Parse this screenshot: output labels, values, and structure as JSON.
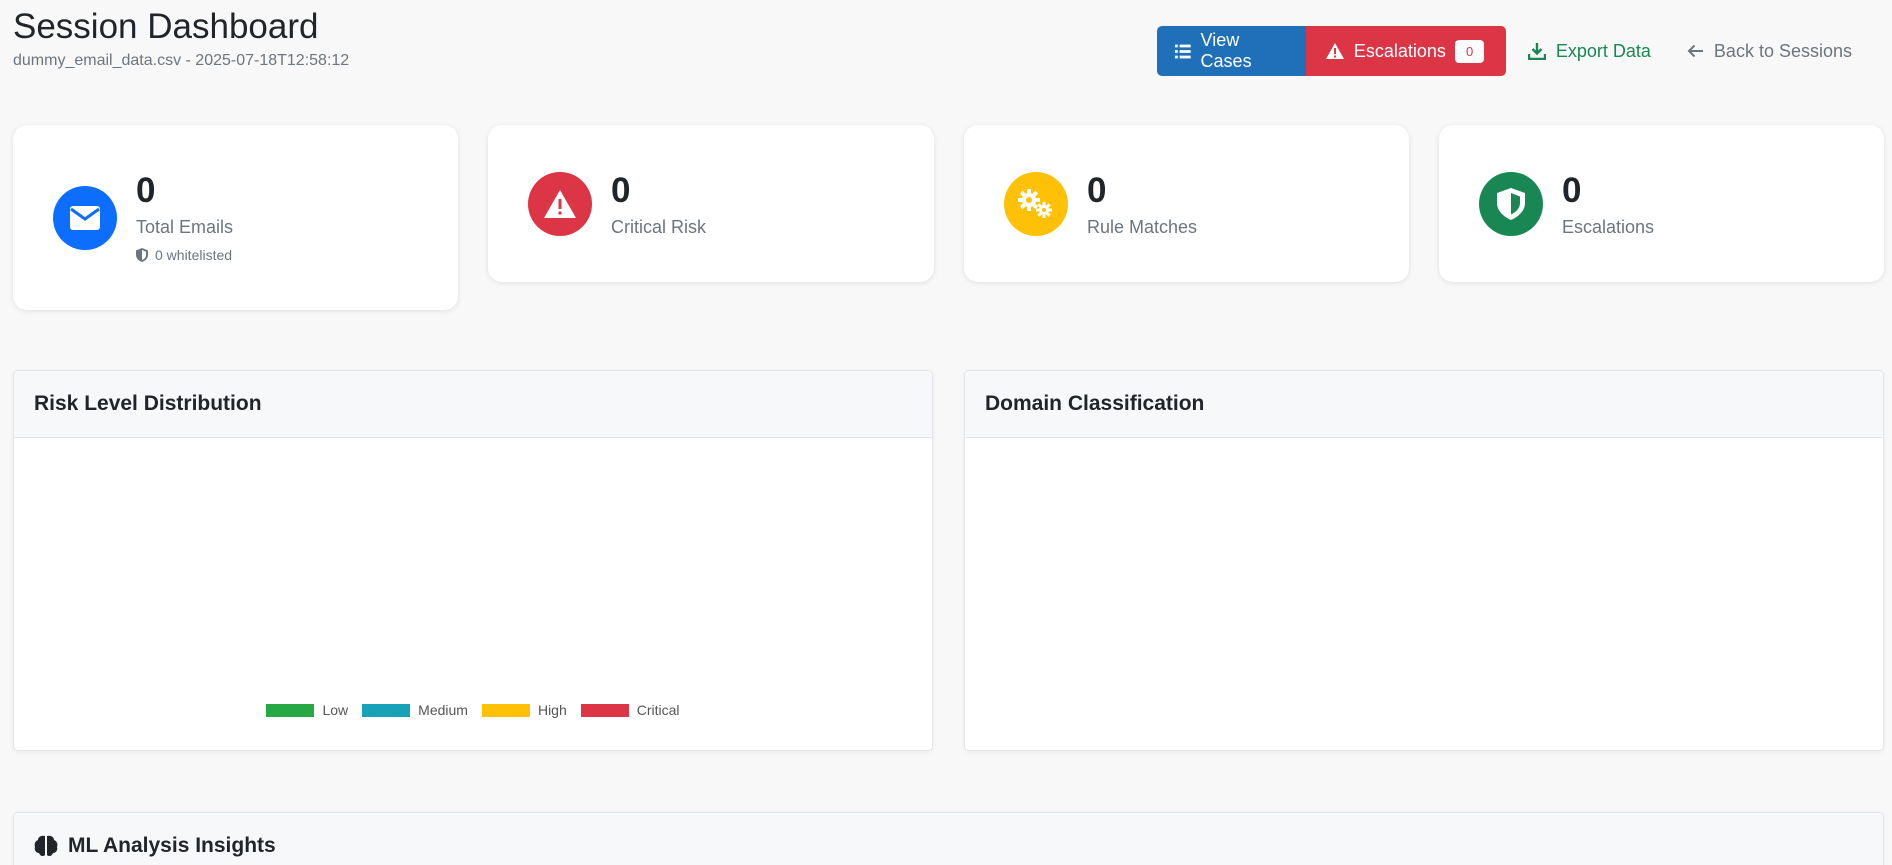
{
  "header": {
    "title": "Session Dashboard",
    "subtitle": "dummy_email_data.csv - 2025-07-18T12:58:12"
  },
  "actions": {
    "view_cases": "View Cases",
    "escalations": "Escalations",
    "escalations_count": "0",
    "export": "Export Data",
    "back": "Back to Sessions"
  },
  "stats": {
    "total_emails": {
      "value": "0",
      "label": "Total Emails",
      "sub": "0 whitelisted",
      "color": "#0d6efd",
      "icon": "envelope-icon"
    },
    "critical_risk": {
      "value": "0",
      "label": "Critical Risk",
      "color": "#dc3545",
      "icon": "warning-icon"
    },
    "rule_matches": {
      "value": "0",
      "label": "Rule Matches",
      "color": "#ffc107",
      "icon": "gears-icon"
    },
    "escalations": {
      "value": "0",
      "label": "Escalations",
      "color": "#198754",
      "icon": "shield-icon"
    }
  },
  "risk_chart": {
    "title": "Risk Level Distribution",
    "legend": [
      {
        "label": "Low",
        "color": "#28a745"
      },
      {
        "label": "Medium",
        "color": "#17a2b8"
      },
      {
        "label": "High",
        "color": "#ffc107"
      },
      {
        "label": "Critical",
        "color": "#dc3545"
      }
    ]
  },
  "domain_chart": {
    "title": "Domain Classification"
  },
  "ml_panel": {
    "title": "ML Analysis Insights"
  }
}
